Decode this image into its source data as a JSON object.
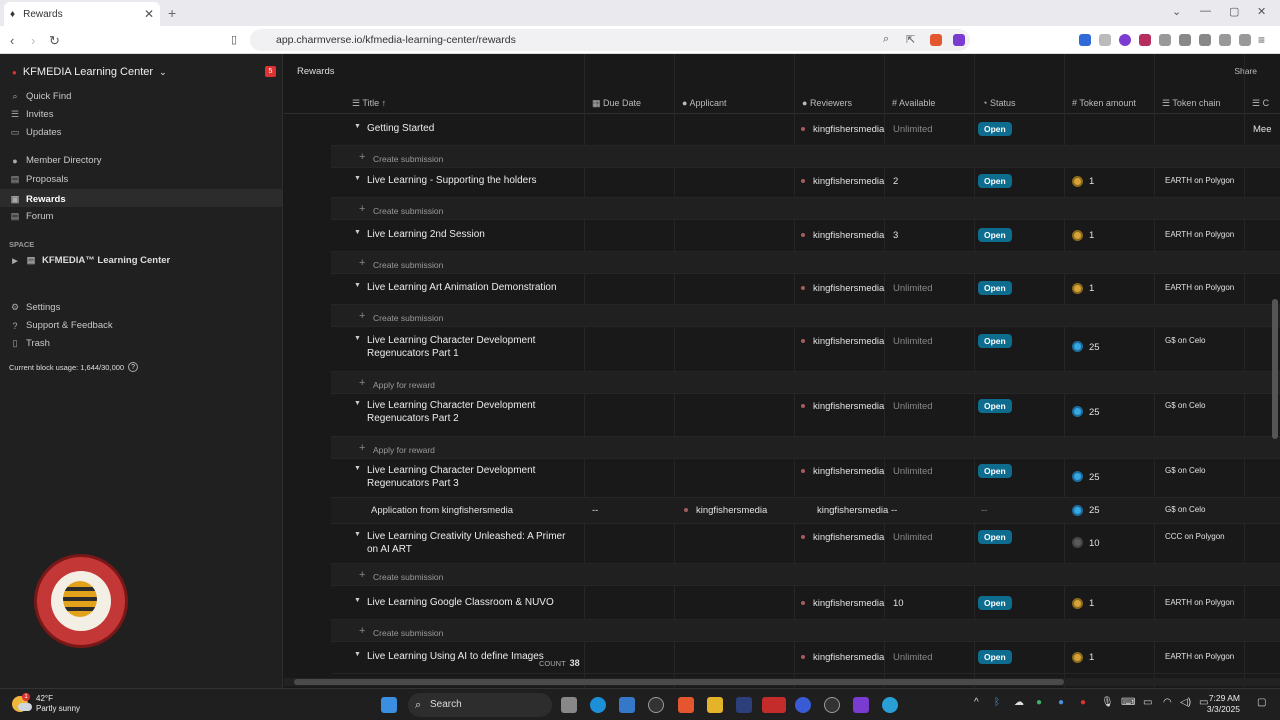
{
  "browser": {
    "tab_title": "Rewards",
    "url": "app.charmverse.io/kfmedia-learning-center/rewards"
  },
  "sidebar": {
    "workspace": "KFMEDIA Learning Center",
    "notification_count": "5",
    "top_items": [
      "Quick Find",
      "Invites",
      "Updates"
    ],
    "main_items": [
      "Member Directory",
      "Proposals",
      "Rewards",
      "Forum"
    ],
    "space_label": "SPACE",
    "space_item": "KFMEDIA™ Learning Center",
    "bottom_items": [
      "Settings",
      "Support & Feedback",
      "Trash"
    ],
    "block_usage": "Current block usage: 1,644/30,000"
  },
  "main": {
    "page_title": "Rewards",
    "share": "Share",
    "columns": [
      "Title",
      "Due Date",
      "Applicant",
      "Reviewers",
      "Available",
      "Status",
      "Token amount",
      "Token chain",
      "C"
    ],
    "reviewer": "kingfishersmedia",
    "status_open": "Open",
    "create_submission": "Create submission",
    "apply_for_reward": "Apply for reward",
    "rows": [
      {
        "title": "Getting Started",
        "available": "Unlimited",
        "amount": "",
        "chain": "",
        "extra": "Mee"
      },
      {
        "title": "Live Learning - Supporting the holders",
        "available": "2",
        "amount": "1",
        "chain": "EARTH on Polygon"
      },
      {
        "title": "Live Learning 2nd Session",
        "available": "3",
        "amount": "1",
        "chain": "EARTH on Polygon"
      },
      {
        "title": "Live Learning Art Animation Demonstration",
        "available": "Unlimited",
        "amount": "1",
        "chain": "EARTH on Polygon"
      },
      {
        "title": "Live Learning Character Development Regenucators Part 1",
        "available": "Unlimited",
        "amount": "25",
        "chain": "G$ on Celo"
      },
      {
        "title": "Live Learning Character Development Regenucators Part 2",
        "available": "Unlimited",
        "amount": "25",
        "chain": "G$ on Celo"
      },
      {
        "title": "Live Learning Character Development Regenucators Part 3",
        "available": "Unlimited",
        "amount": "25",
        "chain": "G$ on Celo"
      },
      {
        "title": "Live Learning Creativity Unleashed: A Primer on AI ART",
        "available": "Unlimited",
        "amount": "10",
        "chain": "CCC on Polygon"
      },
      {
        "title": "Live Learning Google Classroom & NUVO",
        "available": "10",
        "amount": "1",
        "chain": "EARTH on Polygon"
      },
      {
        "title": "Live Learning Using AI to define Images",
        "available": "Unlimited",
        "amount": "1",
        "chain": "EARTH on Polygon"
      }
    ],
    "application": {
      "title": "Application from kingfishersmedia",
      "due": "--",
      "applicant": "kingfishersmedia",
      "available": "--",
      "status": "--",
      "amount": "25",
      "chain": "G$ on Celo"
    },
    "count_label": "COUNT",
    "count_value": "38"
  },
  "taskbar": {
    "temp": "42°F",
    "weather": "Partly sunny",
    "weather_badge": "1",
    "search": "Search",
    "time": "7:29 AM",
    "date": "3/3/2025"
  }
}
